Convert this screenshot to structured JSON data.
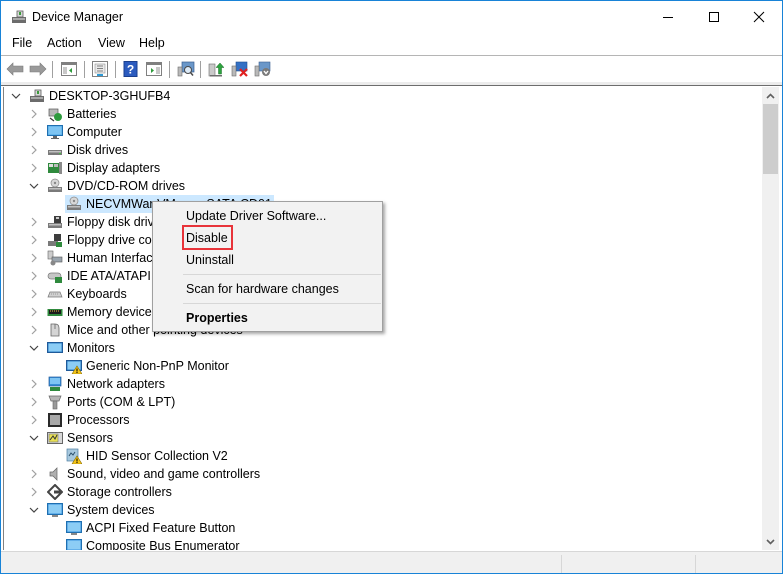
{
  "window": {
    "title": "Device Manager",
    "controls": {
      "minimize": "minimize",
      "maximize": "maximize",
      "close": "close"
    },
    "accent_color": "#1883d7"
  },
  "menubar": {
    "items": [
      "File",
      "Action",
      "View",
      "Help"
    ]
  },
  "toolbar": {
    "buttons": [
      {
        "name": "back",
        "icon": "back-arrow-icon"
      },
      {
        "name": "forward",
        "icon": "forward-arrow-icon"
      },
      {
        "name": "show-hide-console-tree",
        "icon": "console-tree-icon"
      },
      {
        "name": "properties",
        "icon": "properties-icon"
      },
      {
        "name": "help",
        "icon": "help-icon"
      },
      {
        "name": "show-hide-action-pane",
        "icon": "action-pane-icon"
      },
      {
        "name": "scan-hardware",
        "icon": "scan-hardware-icon"
      },
      {
        "name": "update-driver",
        "icon": "update-driver-icon"
      },
      {
        "name": "uninstall-device",
        "icon": "uninstall-device-icon"
      },
      {
        "name": "disable-device",
        "icon": "disable-device-icon"
      }
    ]
  },
  "tree": {
    "root": "DESKTOP-3GHUFB4",
    "items": [
      {
        "label": "Batteries",
        "level": 1,
        "expanded": false,
        "icon": "battery-icon"
      },
      {
        "label": "Computer",
        "level": 1,
        "expanded": false,
        "icon": "computer-icon"
      },
      {
        "label": "Disk drives",
        "level": 1,
        "expanded": false,
        "icon": "disk-drive-icon"
      },
      {
        "label": "Display adapters",
        "level": 1,
        "expanded": false,
        "icon": "display-adapter-icon"
      },
      {
        "label": "DVD/CD-ROM drives",
        "level": 1,
        "expanded": true,
        "icon": "dvd-drive-icon"
      },
      {
        "label": "NECVMWar VMware SATA CD01",
        "level": 2,
        "selected": true,
        "icon": "dvd-drive-icon"
      },
      {
        "label": "Floppy disk drives",
        "level": 1,
        "expanded": false,
        "icon": "floppy-disk-icon"
      },
      {
        "label": "Floppy drive controllers",
        "level": 1,
        "expanded": false,
        "icon": "floppy-controller-icon"
      },
      {
        "label": "Human Interface Devices",
        "level": 1,
        "expanded": false,
        "icon": "hid-icon"
      },
      {
        "label": "IDE ATA/ATAPI controllers",
        "level": 1,
        "expanded": false,
        "icon": "ide-controller-icon"
      },
      {
        "label": "Keyboards",
        "level": 1,
        "expanded": false,
        "icon": "keyboard-icon"
      },
      {
        "label": "Memory devices",
        "level": 1,
        "expanded": false,
        "icon": "memory-icon"
      },
      {
        "label": "Mice and other pointing devices",
        "level": 1,
        "expanded": false,
        "icon": "mouse-icon"
      },
      {
        "label": "Monitors",
        "level": 1,
        "expanded": true,
        "icon": "monitor-icon"
      },
      {
        "label": "Generic Non-PnP Monitor",
        "level": 2,
        "warning": true,
        "icon": "monitor-warning-icon"
      },
      {
        "label": "Network adapters",
        "level": 1,
        "expanded": false,
        "icon": "network-adapter-icon"
      },
      {
        "label": "Ports (COM & LPT)",
        "level": 1,
        "expanded": false,
        "icon": "port-icon"
      },
      {
        "label": "Processors",
        "level": 1,
        "expanded": false,
        "icon": "processor-icon"
      },
      {
        "label": "Sensors",
        "level": 1,
        "expanded": true,
        "icon": "sensor-icon"
      },
      {
        "label": "HID Sensor Collection V2",
        "level": 2,
        "warning": true,
        "icon": "sensor-warning-icon"
      },
      {
        "label": "Sound, video and game controllers",
        "level": 1,
        "expanded": false,
        "icon": "sound-icon"
      },
      {
        "label": "Storage controllers",
        "level": 1,
        "expanded": false,
        "icon": "storage-controller-icon"
      },
      {
        "label": "System devices",
        "level": 1,
        "expanded": true,
        "icon": "system-device-icon"
      },
      {
        "label": "ACPI Fixed Feature Button",
        "level": 2,
        "icon": "system-device-icon"
      },
      {
        "label": "Composite Bus Enumerator",
        "level": 2,
        "icon": "system-device-icon"
      }
    ]
  },
  "context_menu": {
    "items": [
      {
        "label": "Update Driver Software...",
        "bold": false
      },
      {
        "label": "Disable",
        "bold": false,
        "highlighted": true
      },
      {
        "label": "Uninstall",
        "bold": false
      },
      {
        "label": "Scan for hardware changes",
        "bold": false
      },
      {
        "label": "Properties",
        "bold": true
      }
    ],
    "highlight_color": "#e8343a"
  }
}
